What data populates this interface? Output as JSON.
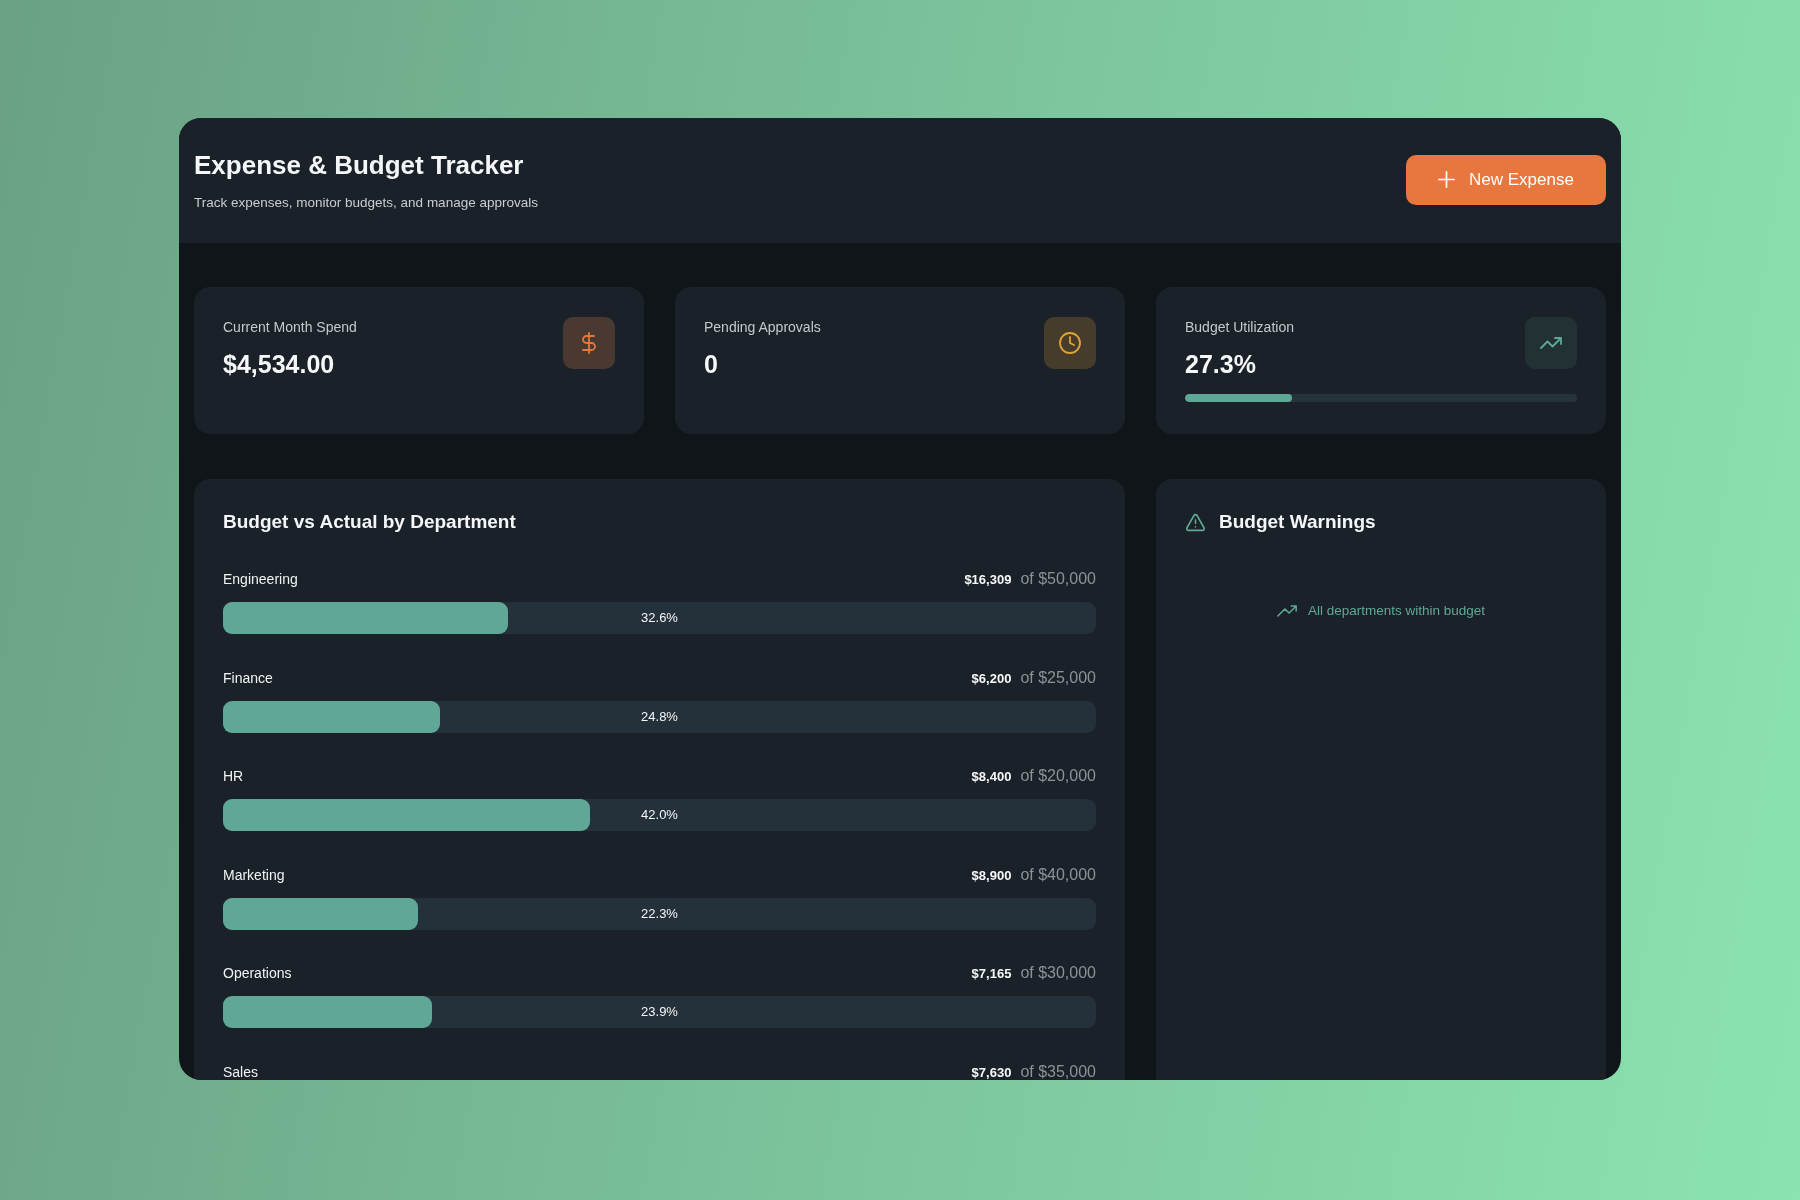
{
  "header": {
    "title": "Expense & Budget Tracker",
    "subtitle": "Track expenses, monitor budgets, and manage approvals",
    "new_button": {
      "label": "New Expense"
    }
  },
  "stats": [
    {
      "kind": "spend",
      "label": "Current Month Spend",
      "value": "$4,534.00"
    },
    {
      "kind": "pending",
      "label": "Pending Approvals",
      "value": "0"
    },
    {
      "kind": "utilization",
      "label": "Budget Utilization",
      "value": "27.3%",
      "level": 0.273
    }
  ],
  "departments_panel": {
    "title": "Budget vs Actual by Department",
    "departments": [
      {
        "name": "Engineering",
        "actual": "$16,309",
        "budget": "of $50,000",
        "level": 0.326,
        "percent": "32.6%"
      },
      {
        "name": "Finance",
        "actual": "$6,200",
        "budget": "of $25,000",
        "level": 0.248,
        "percent": "24.8%"
      },
      {
        "name": "HR",
        "actual": "$8,400",
        "budget": "of $20,000",
        "level": 0.42,
        "percent": "42.0%"
      },
      {
        "name": "Marketing",
        "actual": "$8,900",
        "budget": "of $40,000",
        "level": 0.223,
        "percent": "22.3%"
      },
      {
        "name": "Operations",
        "actual": "$7,165",
        "budget": "of $30,000",
        "level": 0.239,
        "percent": "23.9%"
      },
      {
        "name": "Sales",
        "actual": "$7,630",
        "budget": "of $35,000"
      }
    ]
  },
  "warnings_panel": {
    "title": "Budget Warnings",
    "message": "All departments within budget"
  }
}
